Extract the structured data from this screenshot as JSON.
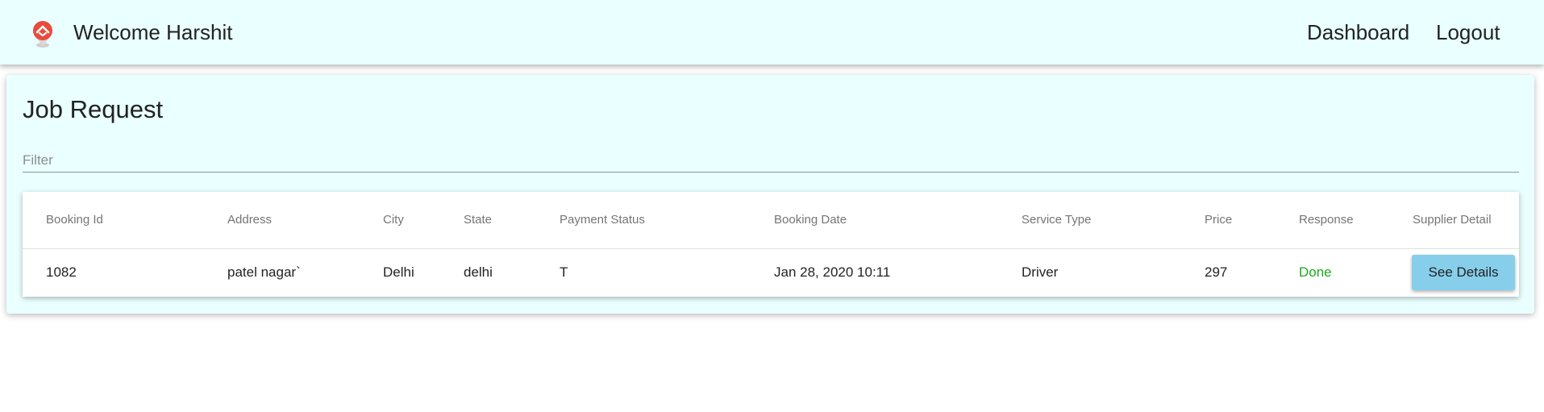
{
  "header": {
    "welcome_text": "Welcome Harshit",
    "logo_icon": "home-pin-icon",
    "nav": [
      {
        "label": "Dashboard"
      },
      {
        "label": "Logout"
      }
    ]
  },
  "main": {
    "title": "Job Request",
    "filter": {
      "placeholder": "Filter",
      "value": ""
    },
    "table": {
      "columns": [
        "Booking Id",
        "Address",
        "City",
        "State",
        "Payment Status",
        "Booking Date",
        "Service Type",
        "Price",
        "Response",
        "Supplier Detail"
      ],
      "rows": [
        {
          "booking_id": "1082",
          "address": "patel nagar`",
          "city": "Delhi",
          "state": "delhi",
          "payment_status": "T",
          "booking_date": "Jan 28, 2020 10:11",
          "service_type": "Driver",
          "price": "297",
          "response": "Done",
          "action_label": "See Details"
        }
      ]
    }
  },
  "colors": {
    "header_bg": "#eaffff",
    "card_bg": "#eaffff",
    "button_bg": "#87ceeb",
    "done_color": "#1aaa1a",
    "logo_red": "#e84c3d"
  }
}
